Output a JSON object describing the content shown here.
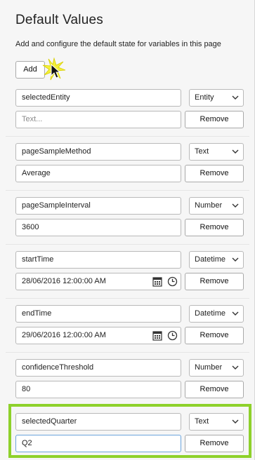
{
  "header": {
    "title": "Default Values",
    "subtitle": "Add and configure the default state for variables in this page",
    "add_label": "Add"
  },
  "remove_label": "Remove",
  "variables": [
    {
      "name": "selectedEntity",
      "type": "Entity",
      "value": "",
      "placeholder": "Text..."
    },
    {
      "name": "pageSampleMethod",
      "type": "Text",
      "value": "Average"
    },
    {
      "name": "pageSampleInterval",
      "type": "Number",
      "value": "3600"
    },
    {
      "name": "startTime",
      "type": "Datetime",
      "value": "28/06/2016 12:00:00 AM"
    },
    {
      "name": "endTime",
      "type": "Datetime",
      "value": "29/06/2016 12:00:00 AM"
    },
    {
      "name": "confidenceThreshold",
      "type": "Number",
      "value": "80"
    },
    {
      "name": "selectedQuarter",
      "type": "Text",
      "value": "Q2"
    }
  ],
  "colors": {
    "highlight": "#8ed12b",
    "focus_border": "#6ba4dc",
    "click_burst": "#f3f03a"
  },
  "icons": {
    "date_picker": "calendar-icon",
    "time_picker": "clock-icon",
    "dropdown": "chevron-down-icon",
    "pointer": "mouse-cursor-icon"
  }
}
